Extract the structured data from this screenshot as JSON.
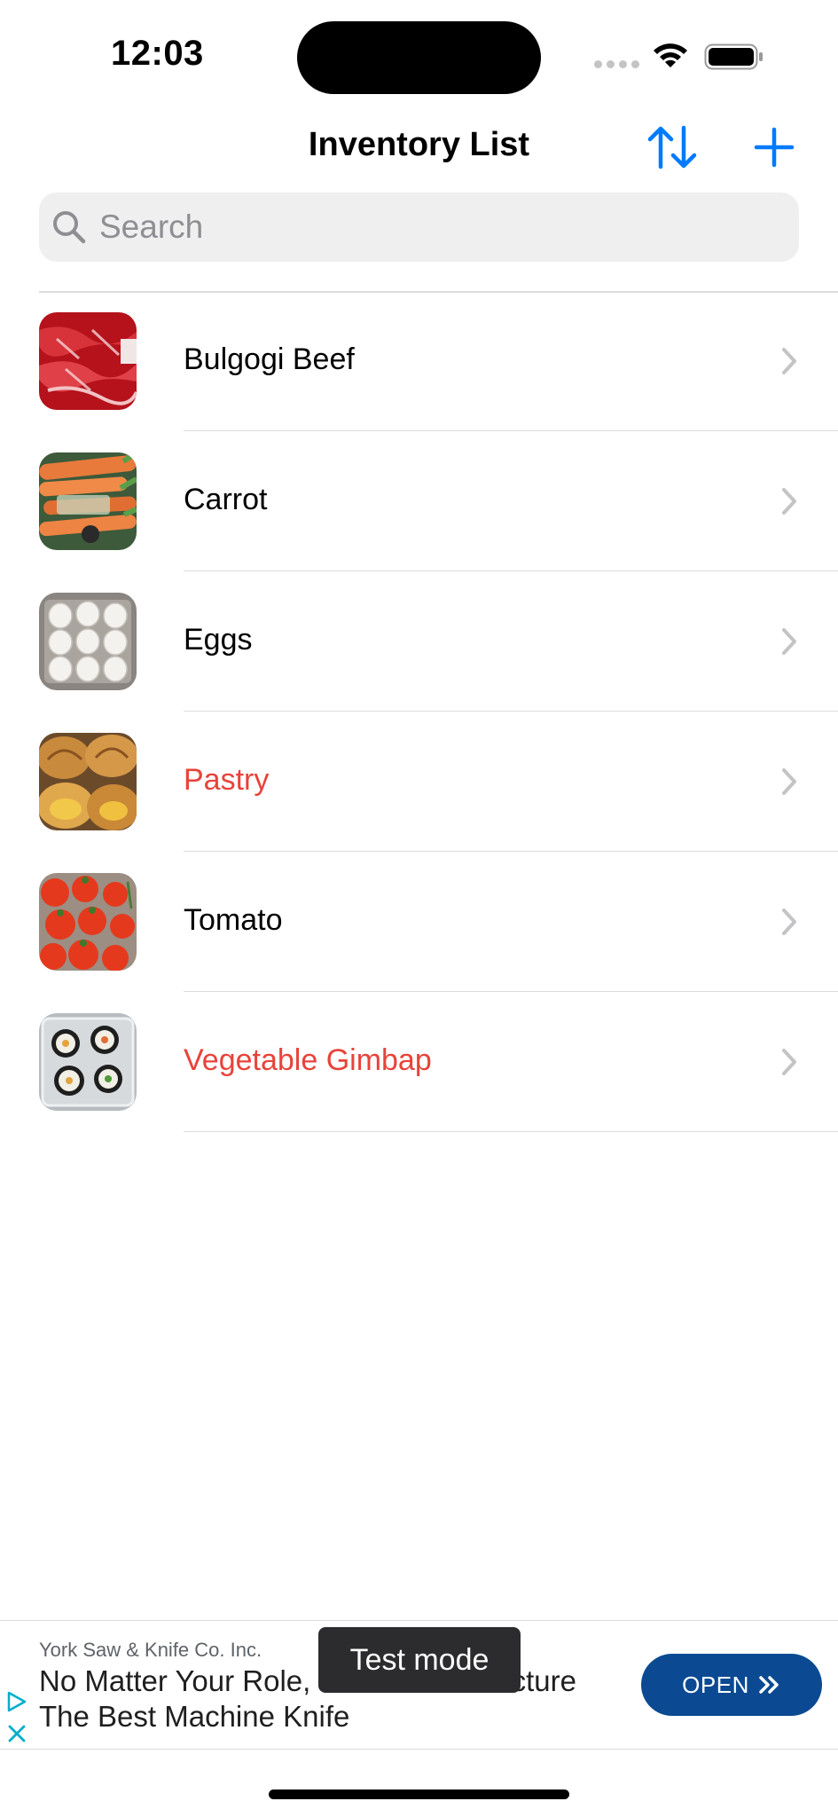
{
  "status_bar": {
    "time": "12:03",
    "signal_icon": "cellular-signal-icon",
    "wifi_icon": "wifi-icon",
    "battery_icon": "battery-icon"
  },
  "nav": {
    "title": "Inventory List",
    "sort_icon": "sort-arrows-icon",
    "add_icon": "plus-icon"
  },
  "search": {
    "placeholder": "Search",
    "value": ""
  },
  "list": {
    "items": [
      {
        "name": "Bulgogi Beef",
        "alert": false,
        "thumb": "beef"
      },
      {
        "name": "Carrot",
        "alert": false,
        "thumb": "carrot"
      },
      {
        "name": "Eggs",
        "alert": false,
        "thumb": "eggs"
      },
      {
        "name": "Pastry",
        "alert": true,
        "thumb": "pastry"
      },
      {
        "name": "Tomato",
        "alert": false,
        "thumb": "tomato"
      },
      {
        "name": "Vegetable Gimbap",
        "alert": true,
        "thumb": "gimbap"
      }
    ]
  },
  "ad": {
    "advertiser": "York Saw & Knife Co. Inc.",
    "headline": "No Matter Your Role, Ysk To Manufacture The Best Machine Knife",
    "open_label": "OPEN",
    "test_mode_label": "Test mode"
  },
  "colors": {
    "accent": "#007aff",
    "alert": "#e8433a",
    "ad_button": "#0b4a92"
  }
}
